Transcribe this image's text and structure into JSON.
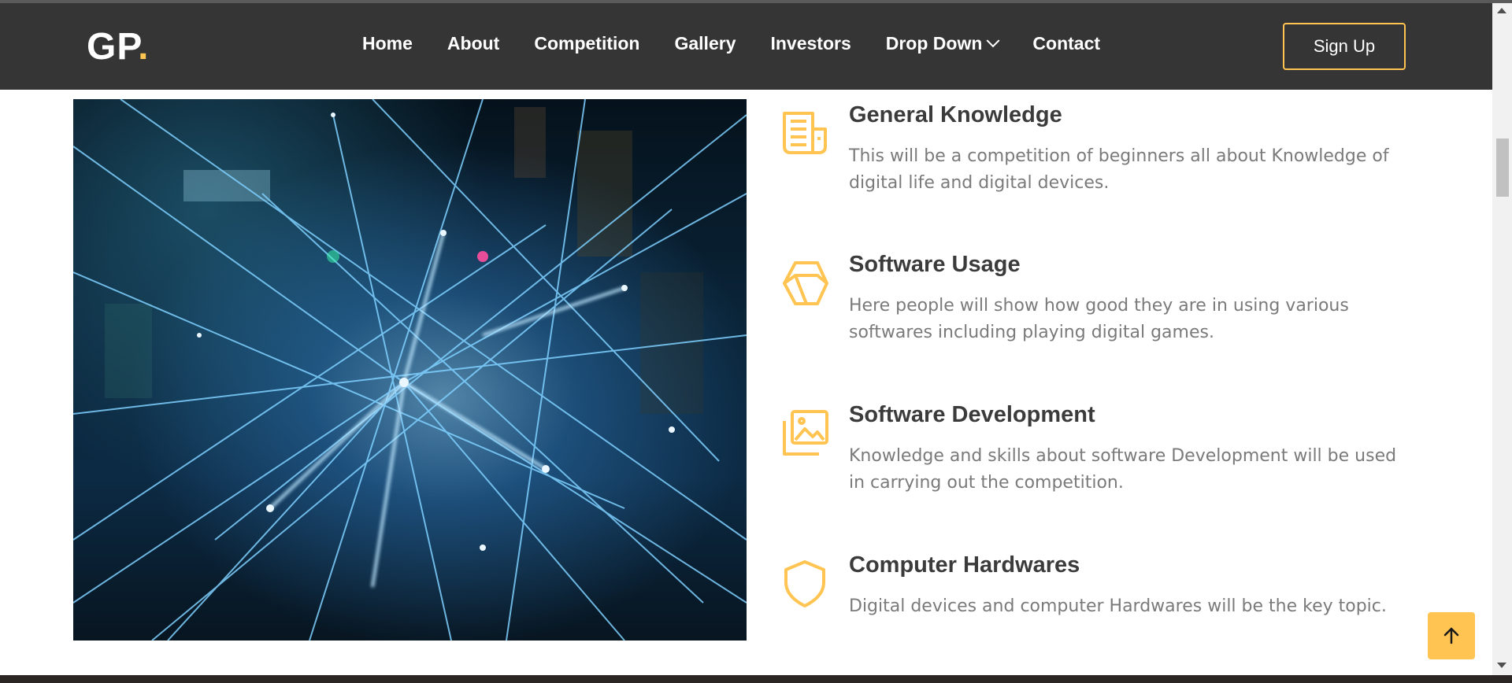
{
  "brand": {
    "logo_text": "GP",
    "logo_dot": "."
  },
  "nav": {
    "items": [
      {
        "label": "Home"
      },
      {
        "label": "About"
      },
      {
        "label": "Competition"
      },
      {
        "label": "Gallery"
      },
      {
        "label": "Investors"
      },
      {
        "label": "Drop Down",
        "has_dropdown": true
      },
      {
        "label": "Contact"
      }
    ],
    "signup_label": "Sign Up"
  },
  "features": [
    {
      "icon": "newspaper-icon",
      "title": "General Knowledge",
      "description": "This will be a competition of beginners all about Knowledge of digital life and digital devices."
    },
    {
      "icon": "box-icon",
      "title": "Software Usage",
      "description": "Here people will show how good they are in using various softwares including playing digital games."
    },
    {
      "icon": "images-icon",
      "title": "Software Development",
      "description": "Knowledge and skills about software Development will be used in carrying out the competition."
    },
    {
      "icon": "shield-icon",
      "title": "Computer Hardwares",
      "description": "Digital devices and computer Hardwares will be the key topic."
    }
  ],
  "colors": {
    "accent": "#ffc451",
    "navbar_bg": "#353535",
    "heading": "#3b3b3b",
    "body_text": "#7a7a7a"
  },
  "back_to_top_icon": "arrow-up-icon"
}
